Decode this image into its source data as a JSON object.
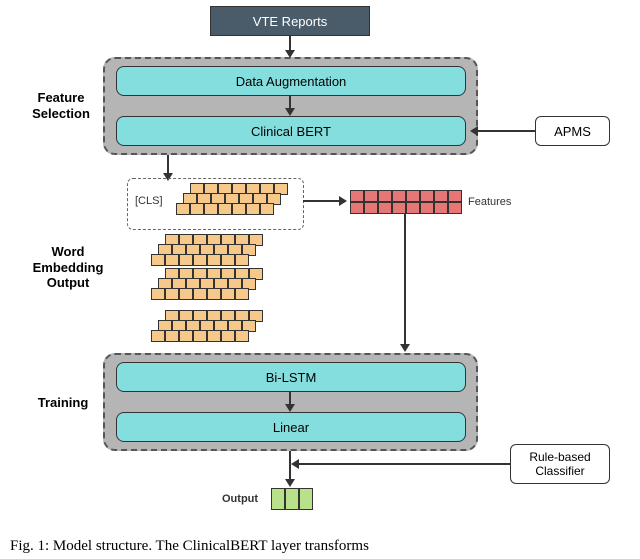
{
  "header": {
    "input_label": "VTE Reports"
  },
  "feature_selection": {
    "section_label": "Feature\nSelection",
    "augmentation_label": "Data Augmentation",
    "bert_label": "Clinical BERT",
    "apms_label": "APMS"
  },
  "embedding": {
    "section_label": "Word\nEmbedding\nOutput",
    "cls_label": "[CLS]",
    "features_label": "Features"
  },
  "training": {
    "section_label": "Training",
    "bilstm_label": "Bi-LSTM",
    "linear_label": "Linear",
    "rule_label": "Rule-based\nClassifier",
    "output_label": "Output"
  },
  "caption": "Fig. 1: Model structure. The ClinicalBERT layer transforms"
}
